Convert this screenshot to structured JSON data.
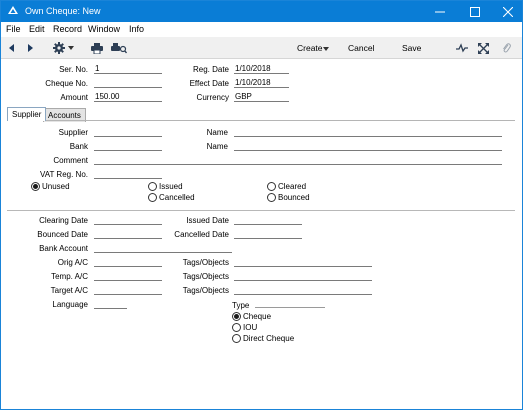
{
  "window": {
    "title": "Own Cheque: New"
  },
  "menu": [
    "File",
    "Edit",
    "Record",
    "Window",
    "Info"
  ],
  "toolbar": {
    "create": "Create",
    "cancel": "Cancel",
    "save": "Save"
  },
  "header": {
    "serno_label": "Ser. No.",
    "serno": "1",
    "chequeno_label": "Cheque No.",
    "chequeno": "",
    "amount_label": "Amount",
    "amount": "150.00",
    "regdate_label": "Reg. Date",
    "regdate": "1/10/2018",
    "effectdate_label": "Effect Date",
    "effectdate": "1/10/2018",
    "currency_label": "Currency",
    "currency": "GBP"
  },
  "tabs": [
    "Supplier",
    "Accounts"
  ],
  "supplier": {
    "supplier_label": "Supplier",
    "supplier": "",
    "name1_label": "Name",
    "name1": "",
    "bank_label": "Bank",
    "bank": "",
    "name2_label": "Name",
    "name2": "",
    "comment_label": "Comment",
    "comment": "",
    "vat_label": "VAT Reg. No.",
    "vat": ""
  },
  "status_options": {
    "unused": "Unused",
    "issued": "Issued",
    "cleared": "Cleared",
    "cancelled": "Cancelled",
    "bounced": "Bounced"
  },
  "status_selected": "Unused",
  "dates": {
    "clearing_label": "Clearing Date",
    "clearing": "",
    "issued_label": "Issued Date",
    "issued": "",
    "bounced_label": "Bounced Date",
    "bounced": "",
    "cancelled_label": "Cancelled Date",
    "cancelled": "",
    "bankaccount_label": "Bank Account",
    "bankaccount": ""
  },
  "accounts": {
    "orig_label": "Orig A/C",
    "orig": "",
    "temp_label": "Temp. A/C",
    "temp": "",
    "target_label": "Target A/C",
    "target": "",
    "tags_label": "Tags/Objects",
    "tags1": "",
    "tags2": "",
    "tags3": "",
    "language_label": "Language",
    "language": ""
  },
  "type": {
    "label": "Type",
    "options": {
      "cheque": "Cheque",
      "iou": "IOU",
      "direct": "Direct Cheque"
    },
    "selected": "Cheque"
  }
}
